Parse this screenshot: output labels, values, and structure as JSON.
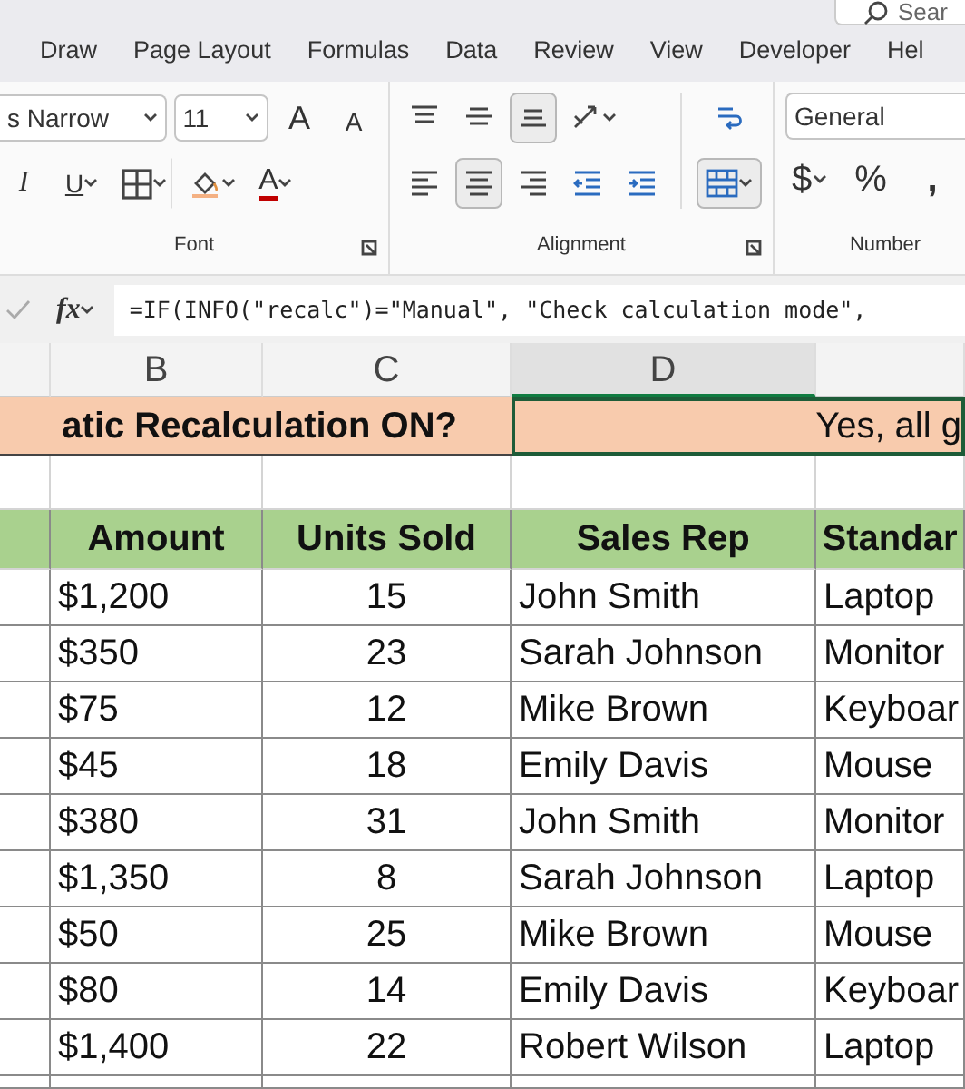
{
  "search": {
    "placeholder": "Sear"
  },
  "tabs": [
    {
      "label": "Draw",
      "selected": false
    },
    {
      "label": "Page Layout",
      "selected": false
    },
    {
      "label": "Formulas",
      "selected": false
    },
    {
      "label": "Data",
      "selected": false
    },
    {
      "label": "Review",
      "selected": false
    },
    {
      "label": "View",
      "selected": false
    },
    {
      "label": "Developer",
      "selected": false
    },
    {
      "label": "Hel",
      "selected": false
    }
  ],
  "ribbon": {
    "font_name": "s Narrow",
    "font_size": "11",
    "font_buttons": [
      {
        "kind": "grow",
        "label": "A"
      },
      {
        "kind": "shrink",
        "label": "A"
      }
    ],
    "format_buttons": [
      {
        "kind": "italic",
        "label": "I"
      },
      {
        "kind": "underline",
        "label": "U"
      },
      {
        "kind": "borders"
      },
      {
        "kind": "fill"
      },
      {
        "kind": "color",
        "label": "A"
      }
    ],
    "align_top": [
      {
        "kind": "top",
        "selected": false
      },
      {
        "kind": "middle",
        "selected": false
      },
      {
        "kind": "bottom",
        "selected": true
      },
      {
        "kind": "orientation",
        "selected": false
      }
    ],
    "align_bottom": [
      {
        "kind": "left",
        "selected": false
      },
      {
        "kind": "center",
        "selected": true
      },
      {
        "kind": "right",
        "selected": false
      },
      {
        "kind": "outdent",
        "selected": false
      },
      {
        "kind": "indent",
        "selected": false
      }
    ],
    "merge": {
      "selected": true
    },
    "number_format": "General",
    "number_buttons": [
      "$",
      "%",
      ","
    ],
    "groups": [
      {
        "label": "Font"
      },
      {
        "label": "Alignment"
      },
      {
        "label": "Number"
      }
    ]
  },
  "formula_bar": {
    "fx": "fx",
    "formula": "=IF(INFO(\"recalc\")=\"Manual\", \"Check calculation mode\","
  },
  "sheet": {
    "column_headers": [
      {
        "label": "B",
        "selected": false
      },
      {
        "label": "C",
        "selected": false
      },
      {
        "label": "D",
        "selected": true
      }
    ],
    "title_row": {
      "question": "atic Recalculation ON?",
      "answer": "Yes, all g"
    },
    "columns": [
      "Amount",
      "Units Sold",
      "Sales Rep",
      "Standar"
    ],
    "rows": [
      [
        "$1,200",
        "15",
        "John Smith",
        "Laptop"
      ],
      [
        "$350",
        "23",
        "Sarah Johnson",
        "Monitor"
      ],
      [
        "$75",
        "12",
        "Mike Brown",
        "Keyboar"
      ],
      [
        "$45",
        "18",
        "Emily Davis",
        "Mouse"
      ],
      [
        "$380",
        "31",
        "John Smith",
        "Monitor"
      ],
      [
        "$1,350",
        "8",
        "Sarah Johnson",
        "Laptop"
      ],
      [
        "$50",
        "25",
        "Mike Brown",
        "Mouse"
      ],
      [
        "$80",
        "14",
        "Emily Davis",
        "Keyboar"
      ],
      [
        "$1,400",
        "22",
        "Robert Wilson",
        "Laptop"
      ]
    ]
  }
}
